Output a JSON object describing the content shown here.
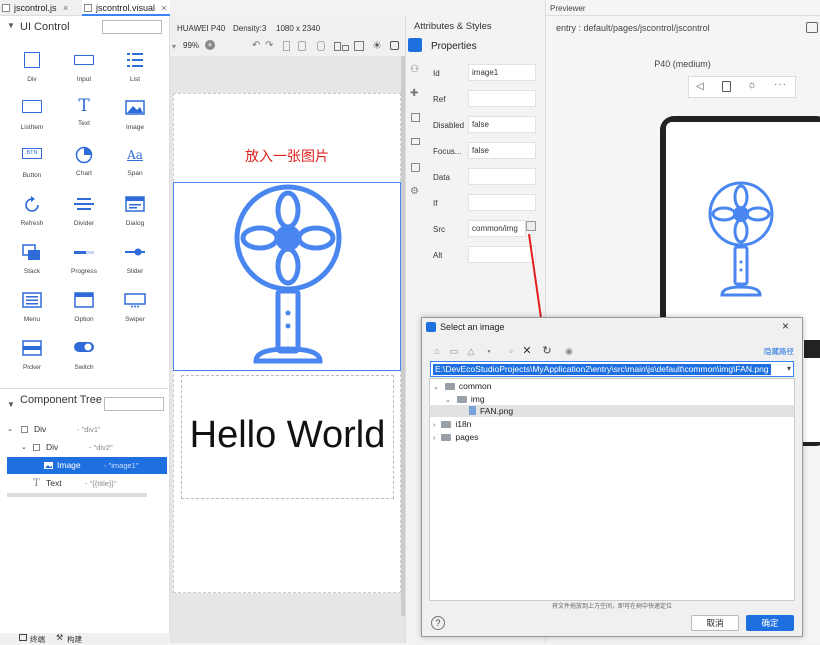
{
  "tabs": [
    {
      "label": "jscontrol.js",
      "close": "×"
    },
    {
      "label": "jscontrol.visual",
      "close": "×"
    }
  ],
  "ui_control": {
    "title": "UI Control",
    "components": [
      {
        "label": "Div",
        "icon": "div-icon"
      },
      {
        "label": "Input",
        "icon": "input-icon"
      },
      {
        "label": "List",
        "icon": "list-icon"
      },
      {
        "label": "ListItem",
        "icon": "listitem-icon"
      },
      {
        "label": "Text",
        "icon": "text-icon"
      },
      {
        "label": "Image",
        "icon": "image-icon"
      },
      {
        "label": "Button",
        "icon": "button-icon"
      },
      {
        "label": "Chart",
        "icon": "chart-icon"
      },
      {
        "label": "Span",
        "icon": "span-icon"
      },
      {
        "label": "Refresh",
        "icon": "refresh-icon"
      },
      {
        "label": "Divider",
        "icon": "divider-icon"
      },
      {
        "label": "Dialog",
        "icon": "dialog-icon"
      },
      {
        "label": "Stack",
        "icon": "stack-icon"
      },
      {
        "label": "Progress",
        "icon": "progress-icon"
      },
      {
        "label": "Slider",
        "icon": "slider-icon"
      },
      {
        "label": "Menu",
        "icon": "menu-icon"
      },
      {
        "label": "Option",
        "icon": "option-icon"
      },
      {
        "label": "Swiper",
        "icon": "swiper-icon"
      },
      {
        "label": "Picker",
        "icon": "picker-icon"
      },
      {
        "label": "Switch",
        "icon": "switch-icon"
      }
    ],
    "button_glyph": "BTN",
    "text_glyph": "T",
    "span_glyph": "Aa"
  },
  "component_tree": {
    "title": "Component Tree",
    "rows": [
      {
        "name": "Div",
        "bind": "- \"div1\""
      },
      {
        "name": "Div",
        "bind": "- \"div2\""
      },
      {
        "name": "Image",
        "bind": "- \"image1\""
      },
      {
        "name": "Text",
        "bind": "- \"{{title}}\""
      }
    ]
  },
  "device_bar": {
    "device": "HUAWEI P40",
    "density": "Density:3",
    "resolution": "1080 x 2340",
    "zoom": "99%"
  },
  "canvas": {
    "heading": "放入一张图片",
    "hello": "Hello World"
  },
  "attributes": {
    "panel_title": "Attributes & Styles",
    "section": "Properties",
    "rows": [
      {
        "label": "Id",
        "value": "image1"
      },
      {
        "label": "Ref",
        "value": ""
      },
      {
        "label": "Disabled",
        "value": "false"
      },
      {
        "label": "Focus...",
        "value": "false"
      },
      {
        "label": "Data",
        "value": ""
      },
      {
        "label": "If",
        "value": ""
      },
      {
        "label": "Src",
        "value": "common/img"
      },
      {
        "label": "Alt",
        "value": ""
      }
    ]
  },
  "previewer": {
    "title": "Previewer",
    "path": "entry : default/pages/jscontrol/jscontrol",
    "device": "P40 (medium)"
  },
  "dialog": {
    "title": "Select an image",
    "hide_path": "隐藏路径",
    "path": "E:\\DevEcoStudioProjects\\MyApplication2\\entry\\src\\main\\js\\default\\common\\img\\FAN.png",
    "tree": [
      {
        "label": "common",
        "level": 0,
        "expanded": true,
        "type": "folder"
      },
      {
        "label": "img",
        "level": 1,
        "expanded": true,
        "type": "folder"
      },
      {
        "label": "FAN.png",
        "level": 2,
        "type": "file"
      },
      {
        "label": "i18n",
        "level": 0,
        "expanded": false,
        "type": "folder"
      },
      {
        "label": "pages",
        "level": 0,
        "expanded": false,
        "type": "folder"
      }
    ],
    "hint": "将文件拖放到上方空间，即可在树中快速定位",
    "help": "?",
    "cancel": "取消",
    "ok": "确定"
  },
  "bottom_bar": {
    "terminal": "终端",
    "build": "构建"
  },
  "colors": {
    "accent": "#1e6fe0",
    "icon_blue": "#4a86f0",
    "canvas_red": "#e02020"
  }
}
